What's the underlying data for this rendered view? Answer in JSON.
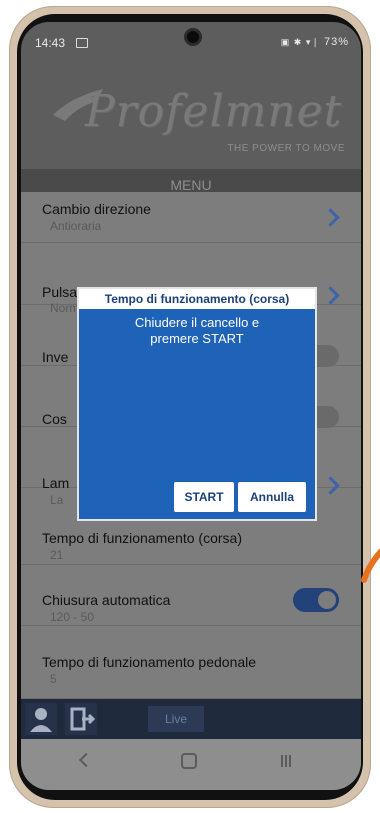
{
  "status_bar": {
    "time": "14:43",
    "battery": "73%",
    "signal_icons": "▣ ✱ ▾❘"
  },
  "logo": {
    "brand": "Profelmnet",
    "tagline": "THE POWER TO MOVE"
  },
  "menu": {
    "label": "MENU"
  },
  "settings": [
    {
      "title": "Cambio direzione",
      "value": "Antioraria"
    },
    {
      "title": "Pulsante esterno",
      "value": "Normale"
    },
    {
      "title": "Inve",
      "value": ""
    },
    {
      "title": "Cos",
      "value": ""
    },
    {
      "title": "Lam",
      "value": "La"
    },
    {
      "title": "Tempo di funzionamento (corsa)",
      "value": "21"
    },
    {
      "title": "Chiusura automatica",
      "value": "120 - 50"
    },
    {
      "title": "Tempo di funzionamento pedonale",
      "value": "5"
    }
  ],
  "dialog": {
    "title": "Tempo di funzionamento (corsa)",
    "message_line1": "Chiudere il cancello e",
    "message_line2": "premere START",
    "start_label": "START",
    "cancel_label": "Annulla"
  },
  "bottom_bar": {
    "live_label": "Live"
  },
  "colors": {
    "accent": "#1e63b8",
    "toggle_on": "#24427a",
    "chevron": "#3f63a8"
  }
}
